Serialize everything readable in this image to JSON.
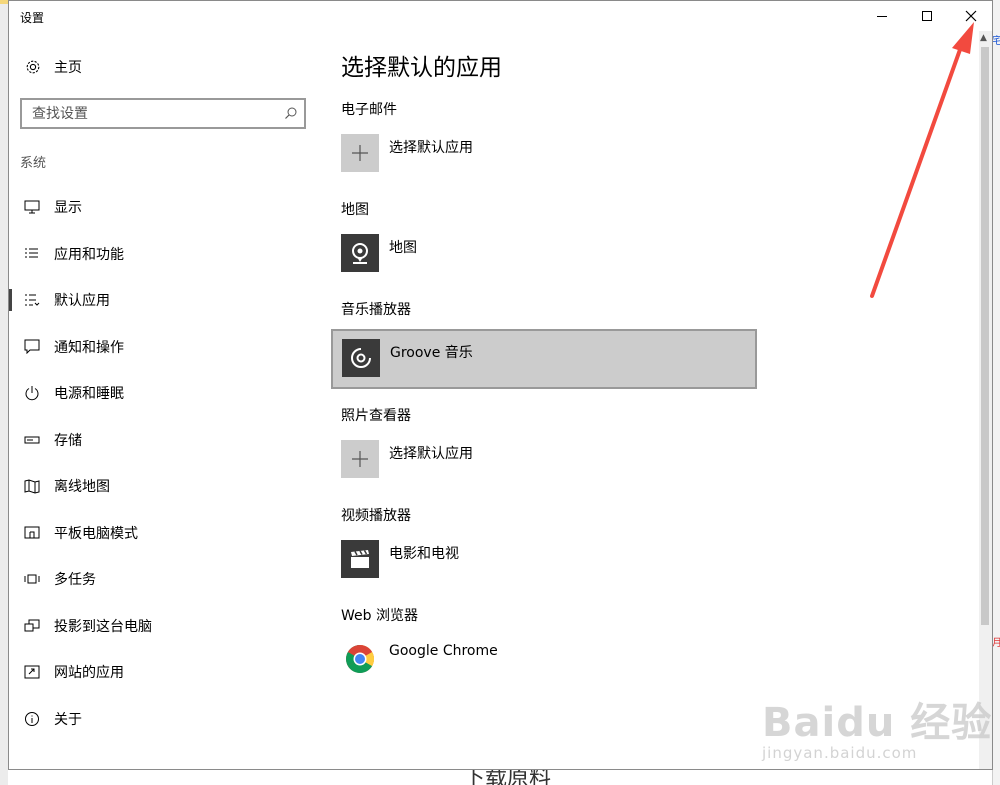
{
  "window": {
    "title": "设置"
  },
  "sidebar": {
    "home_label": "主页",
    "search_placeholder": "查找设置",
    "section_label": "系统",
    "items": [
      {
        "label": "显示",
        "icon": "monitor-icon"
      },
      {
        "label": "应用和功能",
        "icon": "list-icon"
      },
      {
        "label": "默认应用",
        "icon": "default-apps-icon",
        "active": true
      },
      {
        "label": "通知和操作",
        "icon": "message-icon"
      },
      {
        "label": "电源和睡眠",
        "icon": "power-icon"
      },
      {
        "label": "存储",
        "icon": "storage-icon"
      },
      {
        "label": "离线地图",
        "icon": "map-icon"
      },
      {
        "label": "平板电脑模式",
        "icon": "tablet-icon"
      },
      {
        "label": "多任务",
        "icon": "multitask-icon"
      },
      {
        "label": "投影到这台电脑",
        "icon": "project-icon"
      },
      {
        "label": "网站的应用",
        "icon": "web-apps-icon"
      },
      {
        "label": "关于",
        "icon": "info-icon"
      }
    ]
  },
  "main": {
    "title": "选择默认的应用",
    "groups": [
      {
        "label": "电子邮件",
        "app": "选择默认应用",
        "icon": "plus-icon"
      },
      {
        "label": "地图",
        "app": "地图",
        "icon": "maps-app-icon"
      },
      {
        "label": "音乐播放器",
        "app": "Groove 音乐",
        "icon": "groove-music-icon"
      },
      {
        "label": "照片查看器",
        "app": "选择默认应用",
        "icon": "plus-icon"
      },
      {
        "label": "视频播放器",
        "app": "电影和电视",
        "icon": "movies-tv-icon"
      },
      {
        "label": "Web 浏览器",
        "app": "Google Chrome",
        "icon": "chrome-icon"
      }
    ]
  },
  "background": {
    "bottom_text": "下载原料",
    "right_text_top": "宅",
    "right_text_mid": "月"
  },
  "watermark": {
    "main": "Baidu 经验",
    "sub": "jingyan.baidu.com"
  },
  "colors": {
    "annotation_arrow": "#f24a3f",
    "selected_bg": "#cccccc",
    "tile_dark": "#3a3a3a"
  }
}
